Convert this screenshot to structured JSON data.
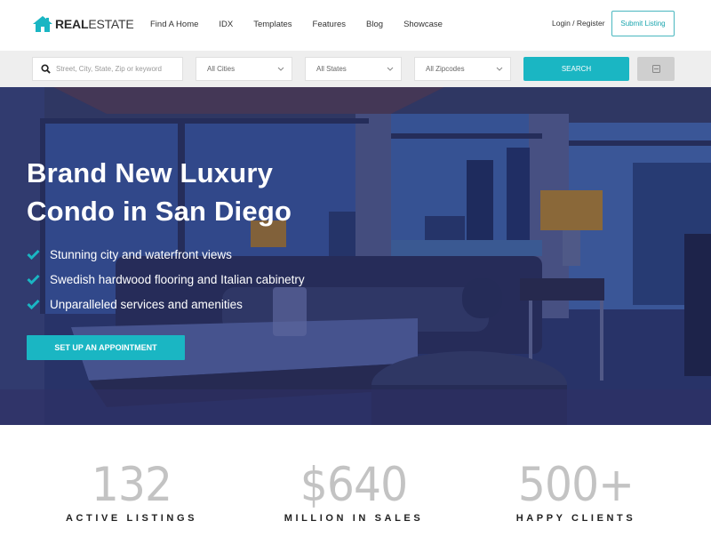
{
  "brand": {
    "logo_bold": "REAL",
    "logo_light": "ESTATE",
    "accent_color": "#1ab6c3"
  },
  "nav": {
    "items": [
      {
        "label": "Find A Home"
      },
      {
        "label": "IDX"
      },
      {
        "label": "Templates"
      },
      {
        "label": "Features"
      },
      {
        "label": "Blog"
      },
      {
        "label": "Showcase"
      }
    ],
    "login_label": "Login / Register",
    "submit_label": "Submit Listing"
  },
  "search": {
    "keyword_placeholder": "Street, City, State, Zip or keyword",
    "keyword_value": "",
    "cities_selected": "All Cities",
    "states_selected": "All States",
    "zip_selected": "All Zipcodes",
    "search_label": "SEARCH",
    "advanced_icon": "advanced-search-icon"
  },
  "hero": {
    "title_line1": "Brand New Luxury",
    "title_line2": "Condo in San Diego",
    "features": [
      "Stunning city and waterfront views",
      "Swedish hardwood flooring and Italian cabinetry",
      "Unparalleled services and amenities"
    ],
    "cta_label": "SET UP AN APPOINTMENT"
  },
  "stats": [
    {
      "value": "132",
      "label": "ACTIVE LISTINGS"
    },
    {
      "value": "$640",
      "label": "MILLION IN SALES"
    },
    {
      "value": "500+",
      "label": "HAPPY CLIENTS"
    }
  ]
}
